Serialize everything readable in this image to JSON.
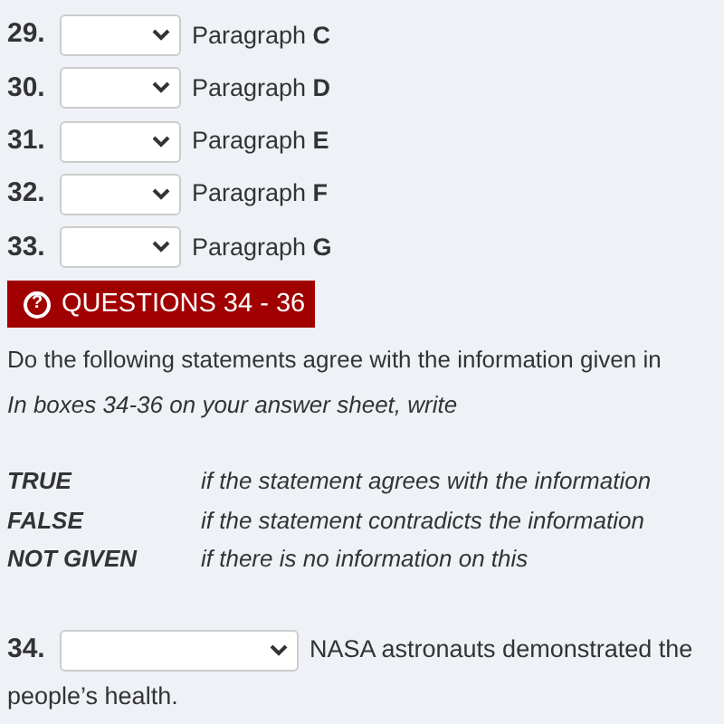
{
  "matching_questions": [
    {
      "number": "29.",
      "text": "Paragraph **C**"
    },
    {
      "number": "30.",
      "text": "Paragraph **D**"
    },
    {
      "number": "31.",
      "text": "Paragraph **E**"
    },
    {
      "number": "32.",
      "text": "Paragraph **F**"
    },
    {
      "number": "33.",
      "text": "Paragraph **G**"
    }
  ],
  "section_header": {
    "icon": "?",
    "title": "QUESTIONS 34 - 36"
  },
  "instruction": "Do the following statements agree with the information given in",
  "instruction_note": "In boxes 34-36 on your answer sheet, write",
  "answer_key": [
    {
      "term": "TRUE",
      "meaning": "if the statement agrees with the information"
    },
    {
      "term": "FALSE",
      "meaning": "if the statement contradicts the information"
    },
    {
      "term": "NOT GIVEN",
      "meaning": "if there is no information on this"
    }
  ],
  "statements": [
    {
      "number": "34.",
      "text_lines": [
        "NASA astronauts demonstrated the",
        "people’s health."
      ]
    }
  ]
}
